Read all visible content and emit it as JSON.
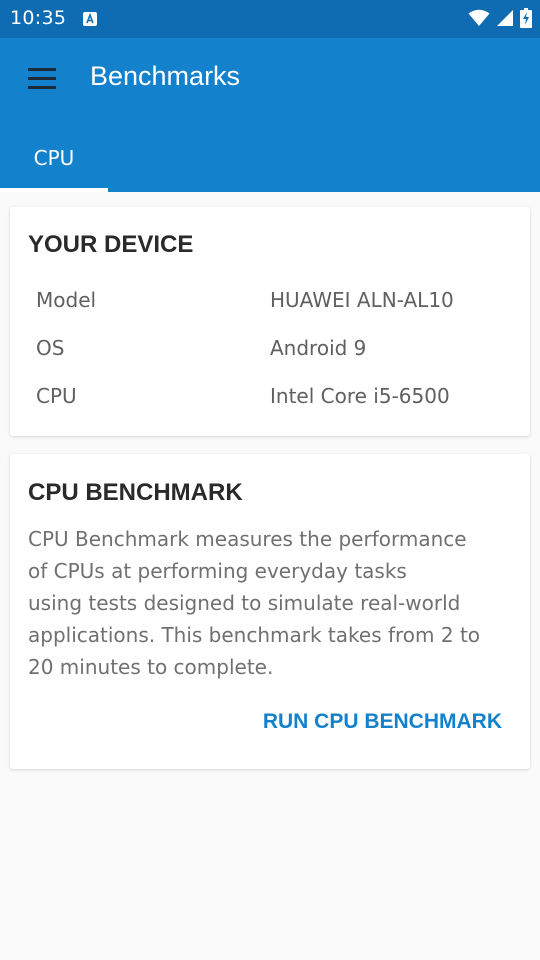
{
  "status_bar": {
    "time": "10:35"
  },
  "app_bar": {
    "title": "Benchmarks",
    "tabs": [
      "CPU"
    ]
  },
  "device_card": {
    "title": "YOUR DEVICE",
    "rows": [
      {
        "label": "Model",
        "value": "HUAWEI ALN-AL10"
      },
      {
        "label": "OS",
        "value": "Android 9"
      },
      {
        "label": "CPU",
        "value": "Intel Core i5-6500"
      }
    ]
  },
  "benchmark_card": {
    "title": "CPU BENCHMARK",
    "lines": [
      "CPU Benchmark measures the performance",
      "of CPUs at performing everyday tasks",
      "using tests designed to simulate real-world",
      "applications. This benchmark takes from 2 to",
      "20 minutes to complete."
    ],
    "action_label": "RUN CPU BENCHMARK"
  },
  "colors": {
    "status_bar": "#0f6cb3",
    "app_bar": "#1481cd",
    "accent": "#1481cd"
  },
  "icons": [
    "notification-a-icon",
    "wifi-icon",
    "signal-icon",
    "battery-charging-icon",
    "hamburger-menu-icon"
  ]
}
